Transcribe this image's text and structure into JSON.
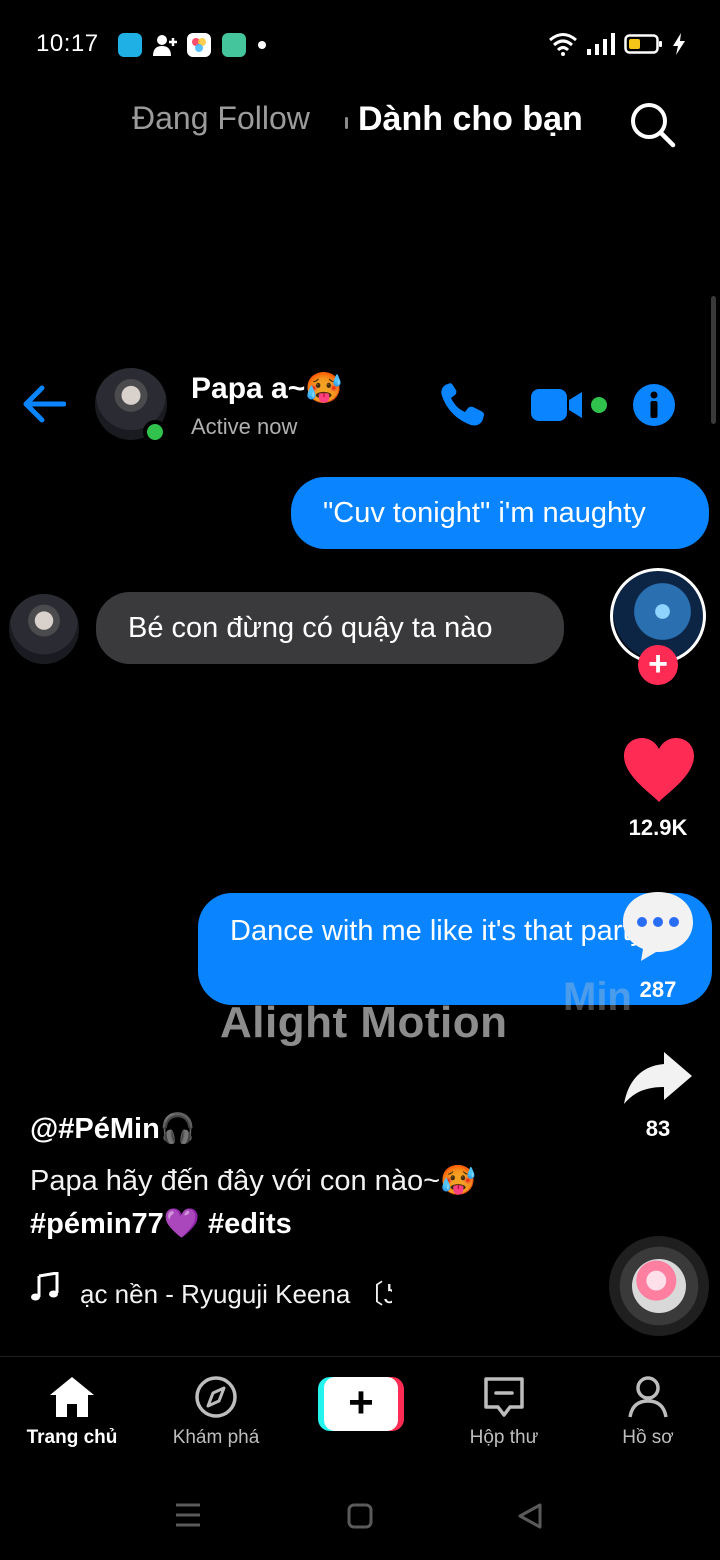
{
  "status_bar": {
    "time": "10:17",
    "notification_icons": [
      "bilibili-icon",
      "add-contact-icon",
      "photos-icon",
      "app-icon",
      "dot-icon"
    ],
    "right_icons": [
      "wifi-icon",
      "signal-icon",
      "battery-icon",
      "charging-icon"
    ]
  },
  "top_tabs": {
    "following": "Đang Follow",
    "for_you": "Dành cho bạn",
    "active": "for_you"
  },
  "chat": {
    "contact_name": "Papa a~🥵",
    "contact_status": "Active now",
    "messages": [
      {
        "from": "me",
        "text": "\"Cuv tonight\" i'm naughty"
      },
      {
        "from": "them",
        "text": "Bé con đừng có quậy ta nào"
      },
      {
        "from": "me",
        "text": "Dance with me like it's that party"
      }
    ]
  },
  "watermarks": {
    "app": "Alight Motion",
    "creator": "Min"
  },
  "actions": {
    "likes": "12.9K",
    "comments": "287",
    "shares": "83",
    "colors": {
      "like": "#fe2c55",
      "follow": "#fe2c55"
    }
  },
  "video": {
    "author": "@#PéMin🎧",
    "caption": "Papa hãy đến đây với con nào~🥵",
    "hashtags": "#pémin77💜 #edits",
    "music": "ạc nền - Ryuguji Keena 〔ʖ"
  },
  "bottom_nav": {
    "items": [
      {
        "label": "Trang chủ",
        "icon": "home-icon"
      },
      {
        "label": "Khám phá",
        "icon": "compass-icon"
      },
      {
        "label": "",
        "icon": "plus-icon"
      },
      {
        "label": "Hộp thư",
        "icon": "inbox-icon"
      },
      {
        "label": "Hồ sơ",
        "icon": "profile-icon"
      }
    ]
  },
  "colors": {
    "messenger_blue": "#0a84ff",
    "incoming_bubble": "#3a3a3c",
    "online": "#31c24d",
    "tiktok_cyan": "#25f4ee",
    "tiktok_red": "#fe2c55"
  }
}
